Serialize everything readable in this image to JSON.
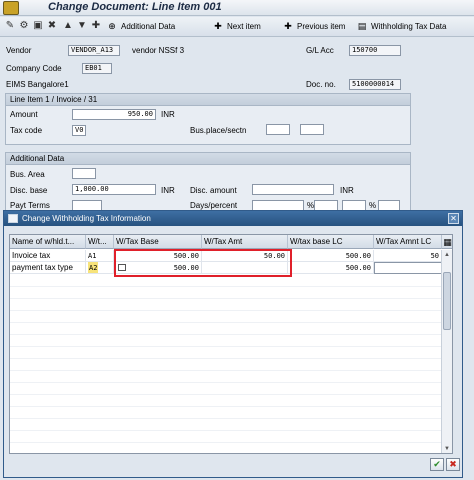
{
  "window": {
    "title": "Change Document: Line Item 001"
  },
  "toolbar": {
    "buttons": [
      {
        "label": "Additional Data",
        "icon": "additional-data-icon"
      },
      {
        "label": "Next item",
        "icon": "next-item-icon"
      },
      {
        "label": "Previous item",
        "icon": "previous-item-icon"
      },
      {
        "label": "Withholding Tax Data",
        "icon": "withholding-tax-icon"
      }
    ]
  },
  "header": {
    "vendor_label": "Vendor",
    "vendor_value": "VENDOR_A13",
    "vendor_name": "vendor NSSf 3",
    "gl_acc_label": "G/L Acc",
    "gl_acc_value": "150700",
    "company_code_label": "Company Code",
    "company_code_value": "EB01",
    "company_name": "EIMS Bangalore1",
    "doc_no_label": "Doc. no.",
    "doc_no_value": "5100000014"
  },
  "line_item": {
    "group_title": "Line Item 1 / Invoice / 31",
    "amount_label": "Amount",
    "amount_value": "950.00",
    "amount_currency": "INR",
    "tax_code_label": "Tax code",
    "tax_code_value": "V0",
    "bus_place_label": "Bus.place/sectn"
  },
  "additional": {
    "group_title": "Additional Data",
    "bus_area_label": "Bus. Area",
    "disc_base_label": "Disc. base",
    "disc_base_value": "1,000.00",
    "disc_base_currency": "INR",
    "disc_amount_label": "Disc. amount",
    "disc_amount_currency": "INR",
    "payt_terms_label": "Payt Terms",
    "days_percent_label": "Days/percent",
    "percent_sign": "%"
  },
  "dialog": {
    "title": "Change Withholding Tax Information",
    "columns": [
      "Name of w/hld.t...",
      "W/t...",
      "W/Tax Base",
      "W/Tax Amt",
      "W/tax base LC",
      "W/Tax Amnt LC"
    ],
    "rows": [
      {
        "name": "Invoice tax",
        "wt": "A1",
        "base": "500.00",
        "amt": "50.00",
        "base_lc": "500.00",
        "amt_lc": "50"
      },
      {
        "name": "payment tax type",
        "wt": "A2",
        "base": "500.00",
        "amt": "",
        "base_lc": "500.00",
        "amt_lc": ""
      }
    ],
    "colors": {
      "highlight": "#e0202a",
      "title_bar": "#27527f",
      "selected_cell": "#f7e37a"
    }
  }
}
